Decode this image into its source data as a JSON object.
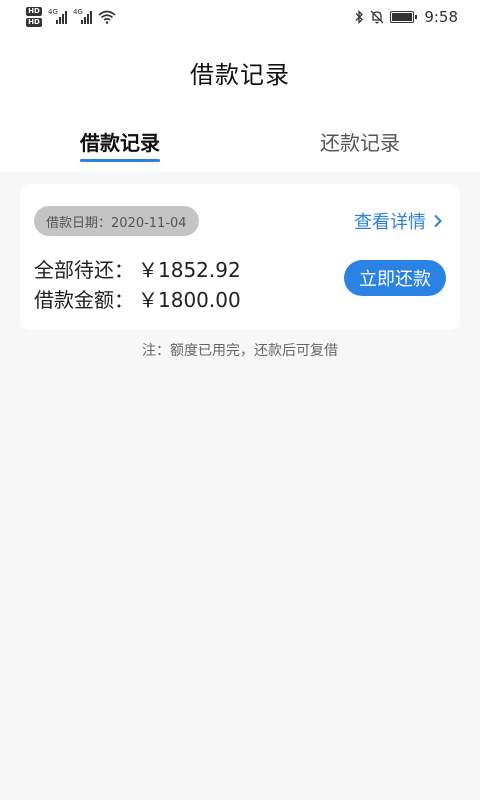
{
  "status_bar": {
    "hd_badges": [
      "HD",
      "HD"
    ],
    "signal_tags": [
      "4G",
      "4G"
    ],
    "time": "9:58",
    "icons": [
      "wifi-icon",
      "bluetooth-icon",
      "mute-bell-icon",
      "battery-icon"
    ]
  },
  "header": {
    "title": "借款记录"
  },
  "tabs": [
    {
      "label": "借款记录",
      "active": true
    },
    {
      "label": "还款记录",
      "active": false
    }
  ],
  "loan_card": {
    "date_label": "借款日期：2020-11-04",
    "detail_link": "查看详情",
    "rows": [
      {
        "label": "全部待还：",
        "value": "￥1852.92"
      },
      {
        "label": "借款金额：",
        "value": "￥1800.00"
      }
    ],
    "repay_button": "立即还款"
  },
  "note": "注：额度已用完，还款后可复借",
  "colors": {
    "accent": "#2a82e4",
    "background": "#f7f7f7",
    "date_pill": "#c4c4c4"
  }
}
